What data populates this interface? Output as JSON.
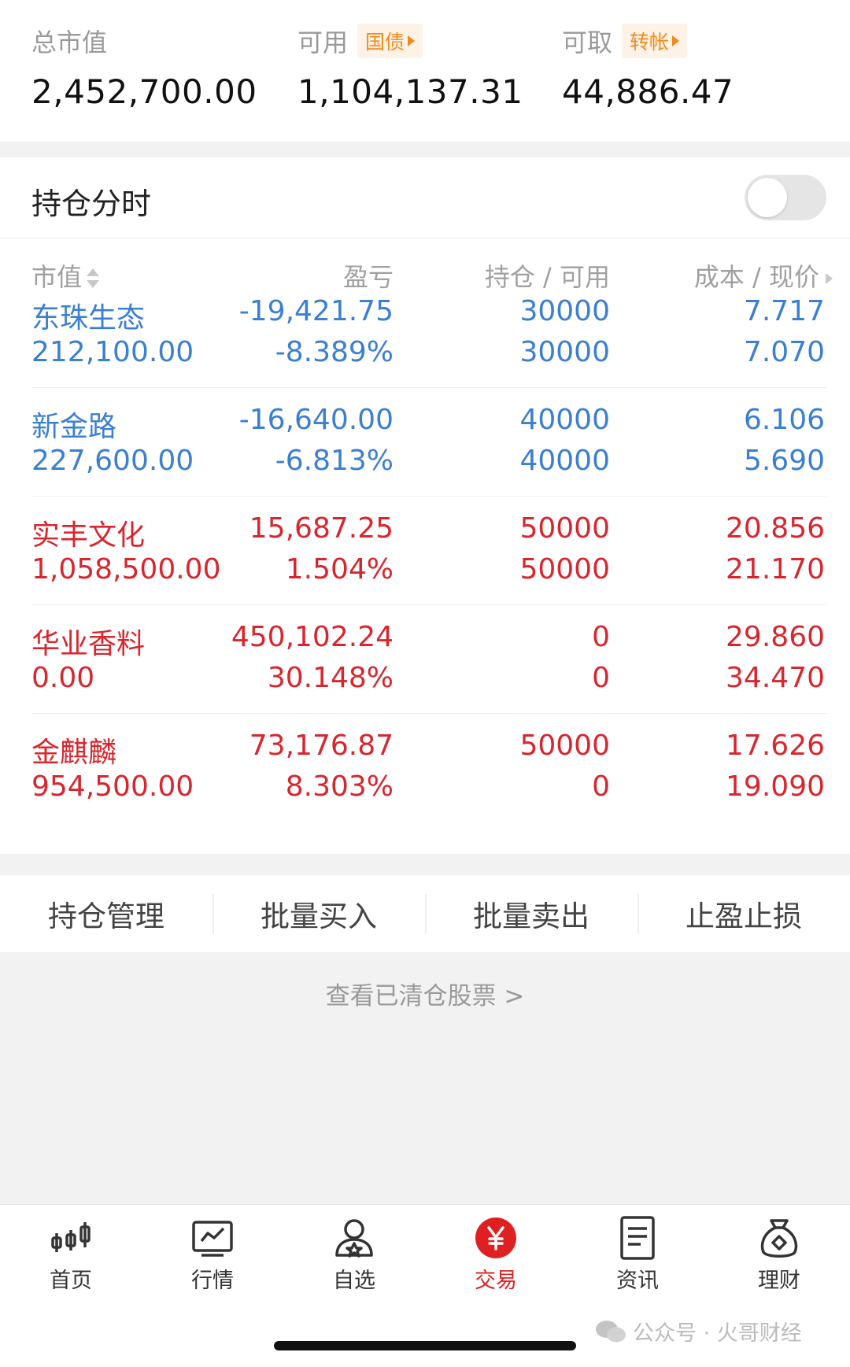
{
  "summary": {
    "total": {
      "label": "总市值",
      "value": "2,452,700.00"
    },
    "available": {
      "label": "可用",
      "tag": "国债",
      "value": "1,104,137.31"
    },
    "withdrawable": {
      "label": "可取",
      "tag": "转帐",
      "value": "44,886.47"
    }
  },
  "toggle_section": {
    "title": "持仓分时",
    "enabled": false
  },
  "table": {
    "headers": {
      "market_value": "市值",
      "pnl": "盈亏",
      "position": "持仓 / 可用",
      "cost": "成本 / 现价"
    },
    "rows": [
      {
        "name": "东珠生态",
        "market_value": "212,100.00",
        "pnl": "-19,421.75",
        "pnl_pct": "-8.389%",
        "position": "30000",
        "available": "30000",
        "cost": "7.717",
        "price": "7.070",
        "trend": "down"
      },
      {
        "name": "新金路",
        "market_value": "227,600.00",
        "pnl": "-16,640.00",
        "pnl_pct": "-6.813%",
        "position": "40000",
        "available": "40000",
        "cost": "6.106",
        "price": "5.690",
        "trend": "down"
      },
      {
        "name": "实丰文化",
        "market_value": "1,058,500.00",
        "pnl": "15,687.25",
        "pnl_pct": "1.504%",
        "position": "50000",
        "available": "50000",
        "cost": "20.856",
        "price": "21.170",
        "trend": "up"
      },
      {
        "name": "华业香料",
        "market_value": "0.00",
        "pnl": "450,102.24",
        "pnl_pct": "30.148%",
        "position": "0",
        "available": "0",
        "cost": "29.860",
        "price": "34.470",
        "trend": "up"
      },
      {
        "name": "金麒麟",
        "market_value": "954,500.00",
        "pnl": "73,176.87",
        "pnl_pct": "8.303%",
        "position": "50000",
        "available": "0",
        "cost": "17.626",
        "price": "19.090",
        "trend": "up"
      }
    ]
  },
  "actions": [
    "持仓管理",
    "批量买入",
    "批量卖出",
    "止盈止损"
  ],
  "cleared_link": "查看已清仓股票 >",
  "nav": [
    {
      "label": "首页",
      "icon": "candlestick-icon"
    },
    {
      "label": "行情",
      "icon": "chart-icon"
    },
    {
      "label": "自选",
      "icon": "user-star-icon"
    },
    {
      "label": "交易",
      "icon": "yuan-icon"
    },
    {
      "label": "资讯",
      "icon": "document-icon"
    },
    {
      "label": "理财",
      "icon": "money-bag-icon"
    }
  ],
  "nav_active": "交易",
  "watermark": "公众号 · 火哥财经",
  "colors": {
    "up": "#d8262e",
    "down": "#3b7fd1",
    "accent": "#e02020",
    "tag": "#f08a1c"
  }
}
